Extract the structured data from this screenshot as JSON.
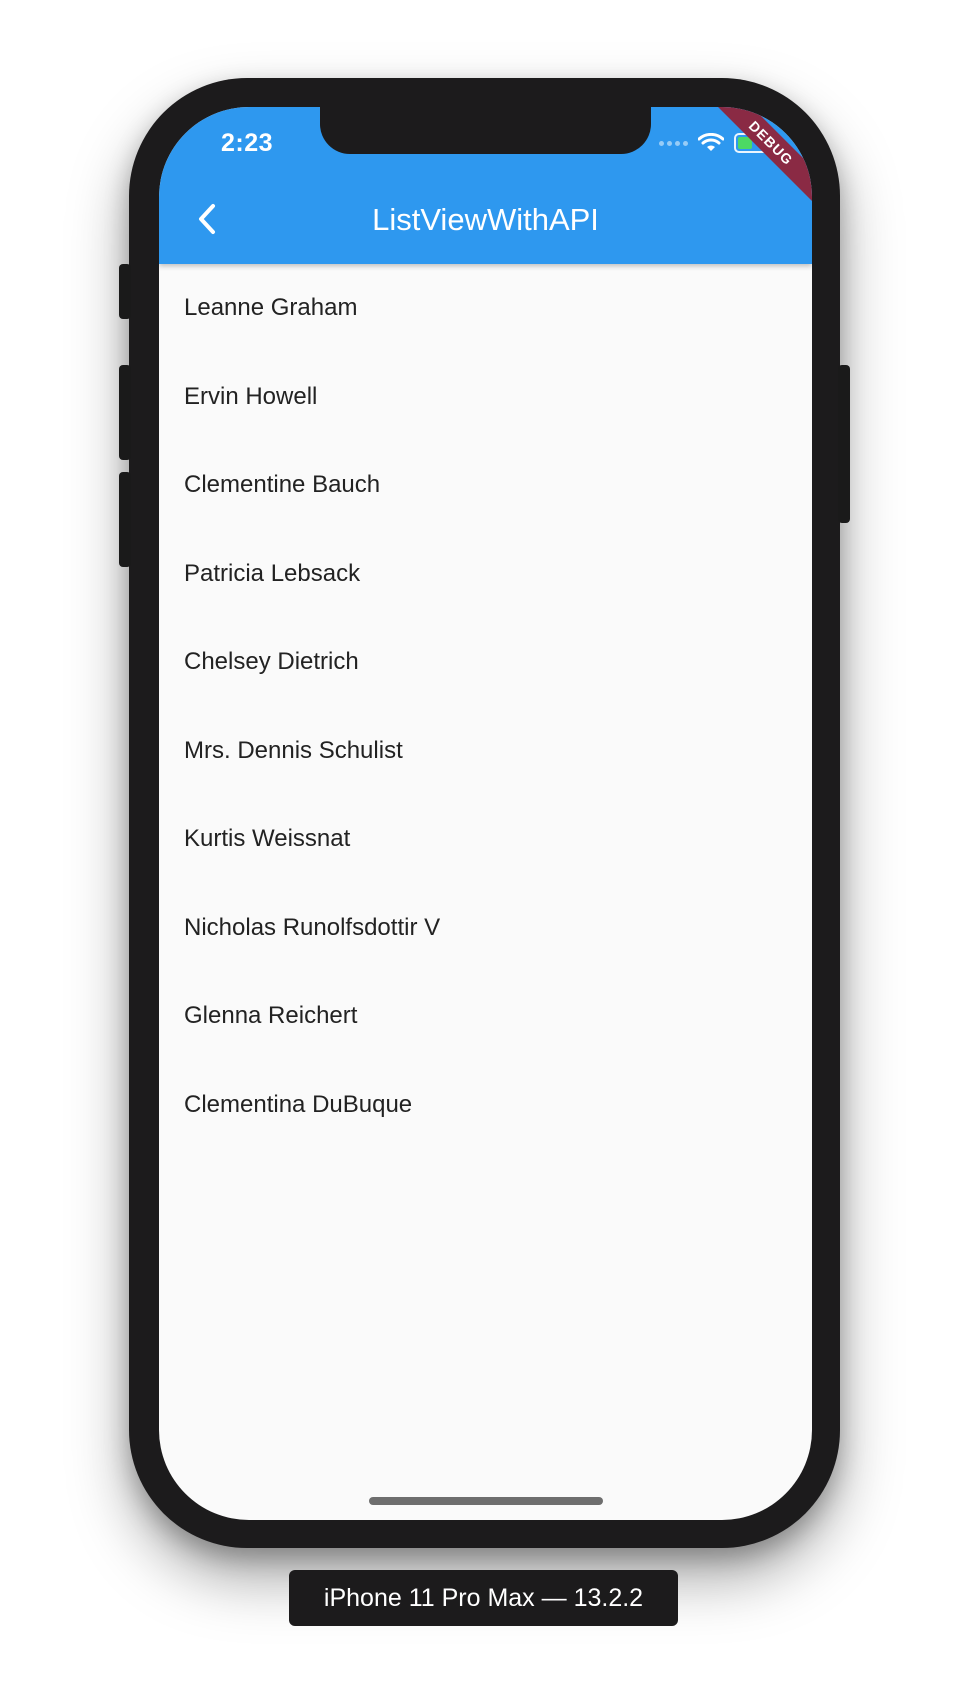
{
  "status_bar": {
    "time": "2:23"
  },
  "app_bar": {
    "title": "ListViewWithAPI"
  },
  "debug_banner": "DEBUG",
  "users": [
    "Leanne Graham",
    "Ervin Howell",
    "Clementine Bauch",
    "Patricia Lebsack",
    "Chelsey Dietrich",
    "Mrs. Dennis Schulist",
    "Kurtis Weissnat",
    "Nicholas Runolfsdottir V",
    "Glenna Reichert",
    "Clementina DuBuque"
  ],
  "device_label": "iPhone 11 Pro Max — 13.2.2",
  "colors": {
    "app_bar": "#2e98ef",
    "background": "#fafafa",
    "debug_banner": "#8a2a44"
  }
}
